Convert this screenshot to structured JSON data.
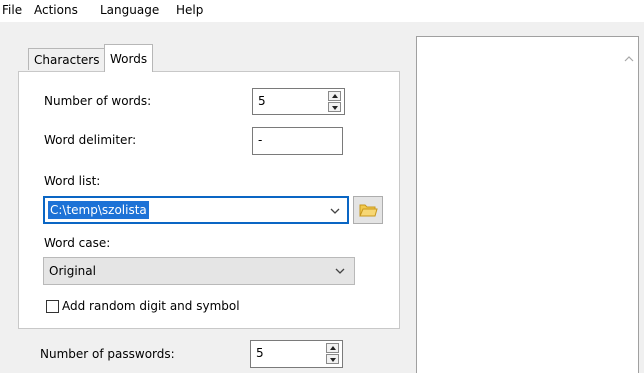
{
  "menu": {
    "file": "File",
    "actions": "Actions",
    "language": "Language",
    "help": "Help"
  },
  "tabs": {
    "characters": "Characters",
    "words": "Words"
  },
  "words_tab": {
    "number_of_words_label": "Number of words:",
    "number_of_words_value": "5",
    "word_delimiter_label": "Word delimiter:",
    "word_delimiter_value": "-",
    "word_list_label": "Word list:",
    "word_list_value": "C:\\temp\\szolista",
    "word_case_label": "Word case:",
    "word_case_value": "Original",
    "random_digit_label": "Add random digit and symbol",
    "random_digit_checked": false
  },
  "bottom": {
    "number_of_passwords_label": "Number of passwords:",
    "number_of_passwords_value": "5"
  },
  "icons": {
    "folder": "folder-icon",
    "chevron": "chevron-down-icon",
    "scroll_up": "scroll-up-icon"
  },
  "colors": {
    "selection": "#1d72d6",
    "focus_border": "#0a66c4",
    "folder": "#f0c040"
  }
}
